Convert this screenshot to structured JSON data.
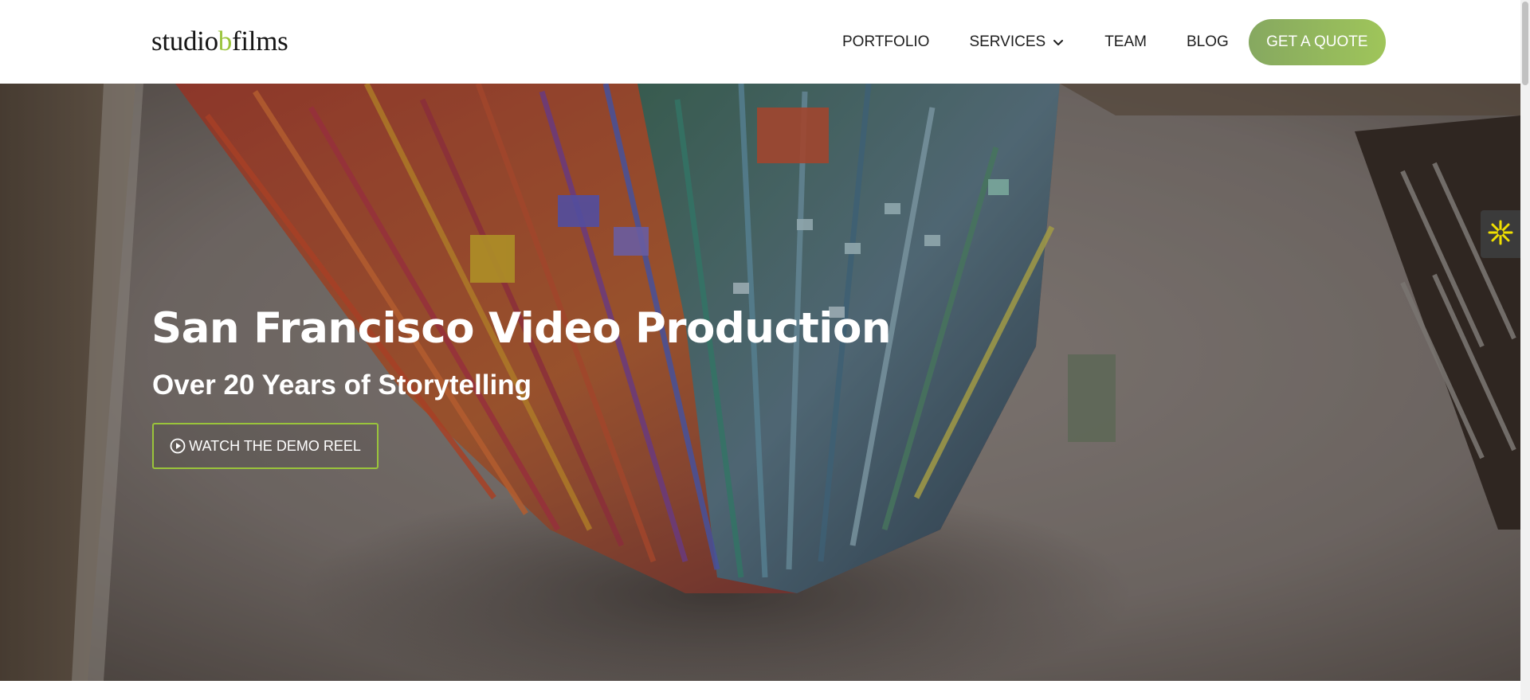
{
  "header": {
    "logo": {
      "prefix": "studio",
      "accent": "b",
      "suffix": "films"
    },
    "nav": {
      "portfolio": "PORTFOLIO",
      "services": "SERVICES",
      "team": "TEAM",
      "blog": "BLOG"
    },
    "cta": "GET A QUOTE"
  },
  "hero": {
    "title": "San Francisco Video Production",
    "subtitle": "Over 20 Years of Storytelling",
    "demo_button": "WATCH THE DEMO REEL"
  },
  "colors": {
    "accent": "#9ac43b",
    "cta_gradient_start": "#86a860",
    "cta_gradient_end": "#9fc55a",
    "widget_star": "#f0e000"
  },
  "icons": {
    "services_dropdown": "chevron-down-icon",
    "demo_play": "play-circle-icon",
    "side_widget": "asterisk-flower-icon"
  }
}
